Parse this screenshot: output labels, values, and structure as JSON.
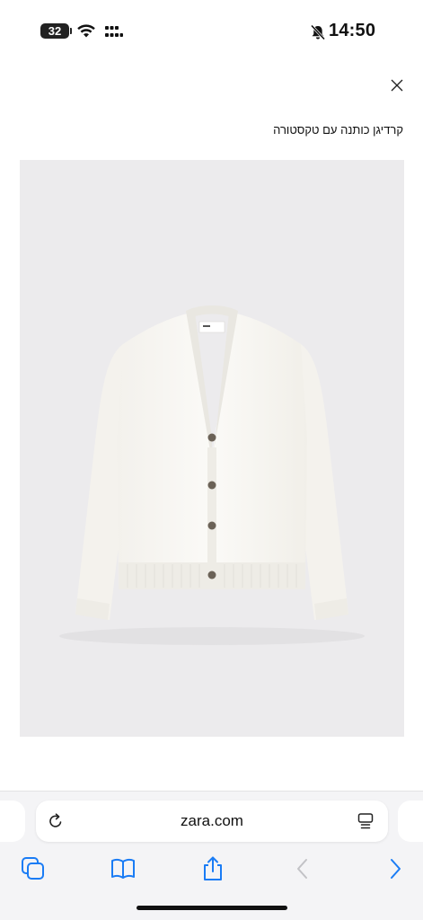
{
  "status_bar": {
    "battery_level": "32",
    "time": "14:50",
    "icons": [
      "wifi-icon",
      "cellular-signal-icon",
      "bell-off-icon"
    ]
  },
  "close": {
    "icon": "close-icon"
  },
  "product": {
    "title": "קרדיגן כותנה עם טקסטורה",
    "image": {
      "subject": "cardigan-image",
      "garment_color": "#f8f6f1",
      "background_color": "#ecebed"
    }
  },
  "browser": {
    "url": "zara.com",
    "icons": {
      "reload": "reload-icon",
      "reader": "reader-mode-icon",
      "tabs": "tabs-icon",
      "bookmarks": "bookmarks-icon",
      "share": "share-icon",
      "back": "back-chevron-icon",
      "forward": "forward-chevron-icon"
    },
    "accent_color": "#1a7cf5"
  }
}
